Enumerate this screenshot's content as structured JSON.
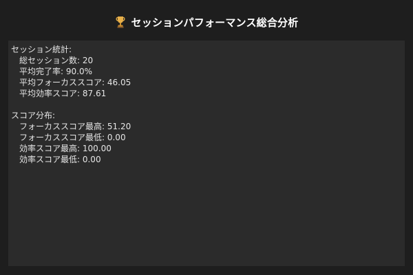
{
  "window": {
    "title": "セッションパフォーマンス総合分析",
    "title_icon": "trophy-icon"
  },
  "stats": {
    "header": "セッション統計:",
    "total_sessions": "総セッション数: 20",
    "avg_completion": "平均完了率: 90.0%",
    "avg_focus": "平均フォーカススコア: 46.05",
    "avg_efficiency": "平均効率スコア: 87.61"
  },
  "distribution": {
    "header": "スコア分布:",
    "focus_max": "フォーカススコア最高: 51.20",
    "focus_min": "フォーカススコア最低: 0.00",
    "efficiency_max": "効率スコア最高: 100.00",
    "efficiency_min": "効率スコア最低: 0.00"
  }
}
